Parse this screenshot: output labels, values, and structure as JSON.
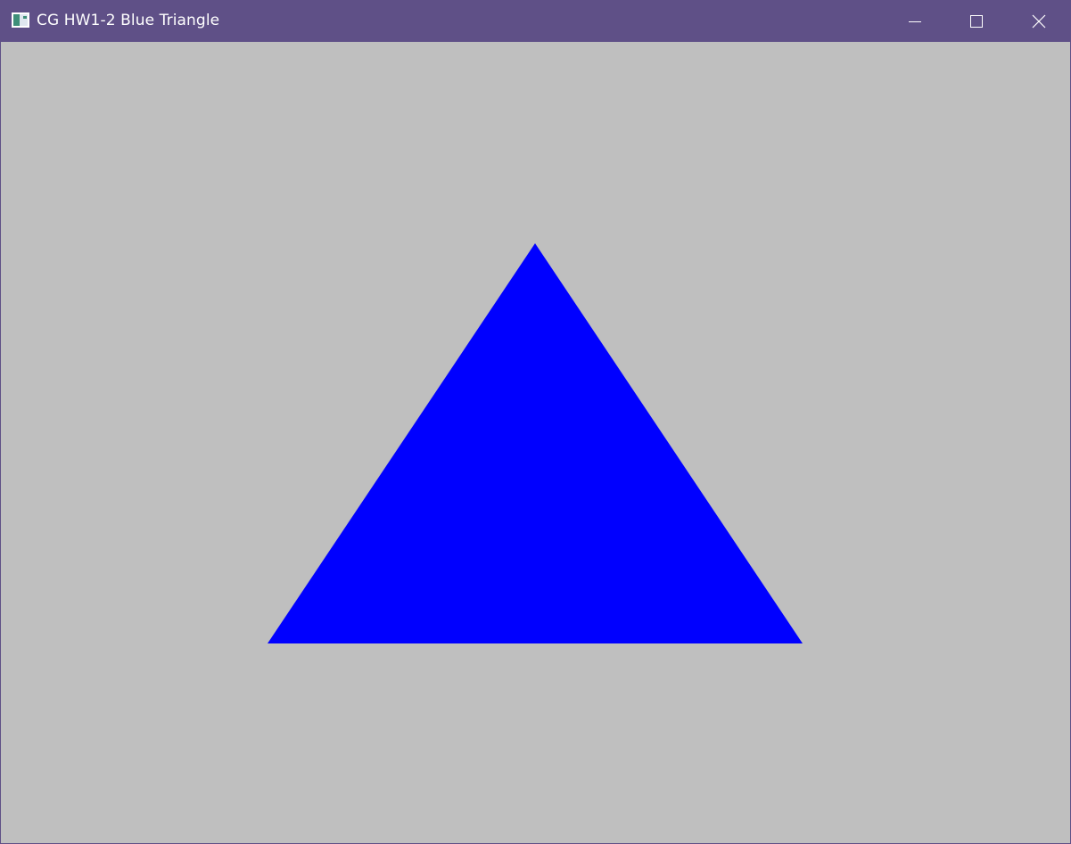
{
  "window": {
    "title": "CG HW1-2 Blue Triangle",
    "controls": {
      "minimize_icon": "minimize-icon",
      "maximize_icon": "maximize-icon",
      "close_icon": "close-icon"
    }
  },
  "colors": {
    "titlebar": "#5f5087",
    "background": "#bfbfbf",
    "triangle": "#0000ff"
  }
}
